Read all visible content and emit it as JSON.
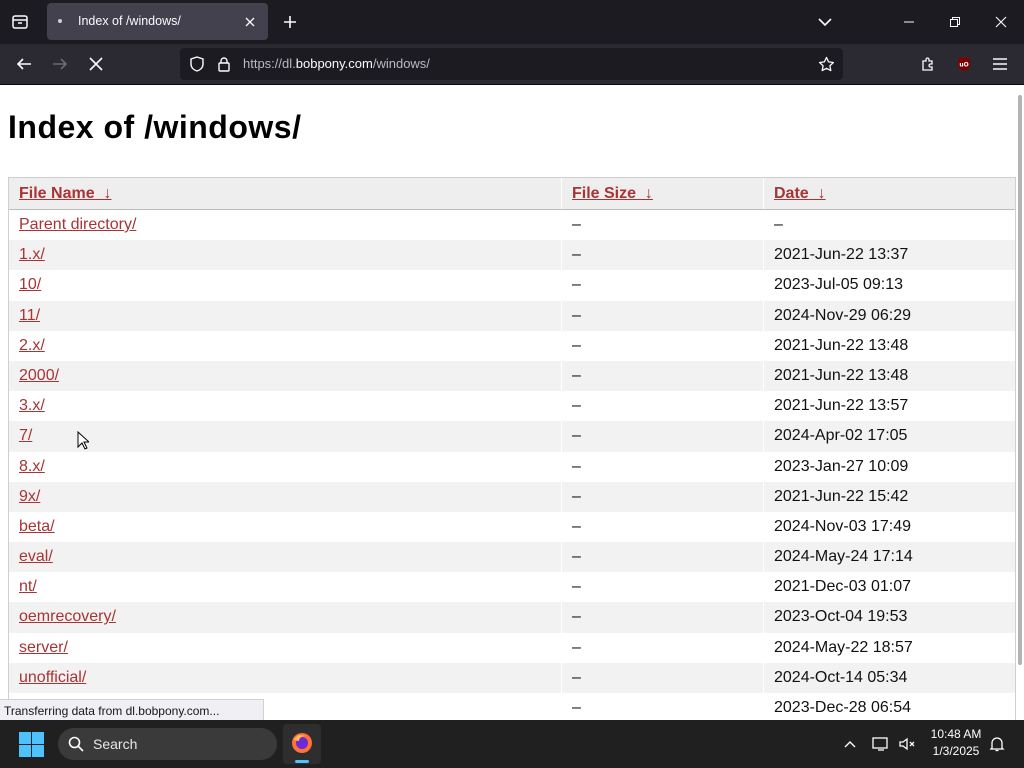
{
  "browser": {
    "tab_title": "Index of /windows/",
    "url_prefix": "https://dl.",
    "url_domain": "bobpony.com",
    "url_path": "/windows/",
    "status_text": "Transferring data from dl.bobpony.com..."
  },
  "page": {
    "title": "Index of /windows/",
    "columns": [
      {
        "label": "File Name",
        "sort_icon": "arrow-down"
      },
      {
        "label": "File Size",
        "sort_icon": "arrow-down"
      },
      {
        "label": "Date",
        "sort_icon": "arrow-down"
      }
    ],
    "rows": [
      {
        "name": "Parent directory/",
        "size": "–",
        "date": "–"
      },
      {
        "name": "1.x/",
        "size": "–",
        "date": "2021-Jun-22 13:37"
      },
      {
        "name": "10/",
        "size": "–",
        "date": "2023-Jul-05 09:13"
      },
      {
        "name": "11/",
        "size": "–",
        "date": "2024-Nov-29 06:29"
      },
      {
        "name": "2.x/",
        "size": "–",
        "date": "2021-Jun-22 13:48"
      },
      {
        "name": "2000/",
        "size": "–",
        "date": "2021-Jun-22 13:48"
      },
      {
        "name": "3.x/",
        "size": "–",
        "date": "2021-Jun-22 13:57"
      },
      {
        "name": "7/",
        "size": "–",
        "date": "2024-Apr-02 17:05"
      },
      {
        "name": "8.x/",
        "size": "–",
        "date": "2023-Jan-27 10:09"
      },
      {
        "name": "9x/",
        "size": "–",
        "date": "2021-Jun-22 15:42"
      },
      {
        "name": "beta/",
        "size": "–",
        "date": "2024-Nov-03 17:49"
      },
      {
        "name": "eval/",
        "size": "–",
        "date": "2024-May-24 17:14"
      },
      {
        "name": "nt/",
        "size": "–",
        "date": "2021-Dec-03 01:07"
      },
      {
        "name": "oemrecovery/",
        "size": "–",
        "date": "2023-Oct-04 19:53"
      },
      {
        "name": "server/",
        "size": "–",
        "date": "2024-May-22 18:57"
      },
      {
        "name": "unofficial/",
        "size": "–",
        "date": "2024-Oct-14 05:34"
      },
      {
        "name": "",
        "size": "–",
        "date": "2023-Dec-28 06:54"
      }
    ]
  },
  "taskbar": {
    "search_label": "Search",
    "time": "10:48 AM",
    "date": "1/3/2025"
  },
  "colors": {
    "link": "#aa3333",
    "accent": "#4cc2ff",
    "header_bg": "#eeeeee",
    "row_alt_bg": "#f2f2f2"
  }
}
